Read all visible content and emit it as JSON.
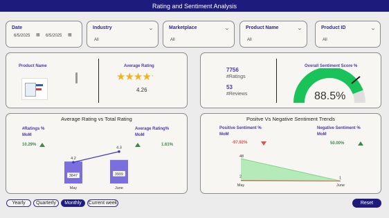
{
  "title": "Rating and Sentiment Analysis",
  "filters": {
    "date": {
      "label": "Date",
      "from": "6/5/2025",
      "to": "6/5/2025"
    },
    "industry": {
      "label": "Industry",
      "value": "All"
    },
    "marketplace": {
      "label": "Marketplace",
      "value": "All"
    },
    "product_name": {
      "label": "Product Name",
      "value": "All"
    },
    "product_id": {
      "label": "Product ID",
      "value": "All"
    }
  },
  "product_card": {
    "product_label": "Product Name",
    "avg_label": "Average Rating",
    "avg_value": "4.26",
    "stars": 4.26
  },
  "sentiment_card": {
    "ratings_count": "7756",
    "ratings_label": "#Ratings",
    "reviews_count": "53",
    "reviews_label": "#Reviews",
    "score_label": "Overall Sentiment Score %",
    "score_value": "88.5%",
    "score_fraction": 0.885
  },
  "avg_total_chart": {
    "title": "Average Rating vs Total Rating",
    "left_kpi_label_1": "#Ratings %",
    "left_kpi_label_2": "MoM",
    "left_kpi_value": "10.29%",
    "right_kpi_label_1": "Average Rating%",
    "right_kpi_label_2": "MoM",
    "right_kpi_value": "1.61%",
    "colors": {
      "bar": "#7b6fe0",
      "line": "#3b3ab8",
      "up": "#3a8a4a"
    }
  },
  "sentiment_chart": {
    "title": "Positve Vs Negative Sentiment Trends",
    "pos_label_1": "Positive Sentiment %",
    "pos_label_2": "MoM",
    "pos_value": "-97.92%",
    "neg_label_1": "Negative Sentiment %",
    "neg_label_2": "MoM",
    "neg_value": "50.00%",
    "colors": {
      "positive": "#9fe6a6",
      "negative": "#e04848",
      "down": "#d9534f",
      "up": "#3a8a4a"
    }
  },
  "chart_data": [
    {
      "type": "bar",
      "title": "Average Rating vs Total Rating",
      "categories": [
        "May",
        "June"
      ],
      "series": [
        {
          "values": [
            3847,
            3909
          ]
        },
        {
          "values": [
            4.2,
            4.3
          ]
        }
      ]
    },
    {
      "type": "area",
      "title": "Positve Vs Negative Sentiment Trends",
      "categories": [
        "May",
        "June"
      ],
      "series": [
        {
          "values": [
            48,
            1
          ]
        },
        {
          "values": [
            2,
            1
          ]
        }
      ]
    }
  ],
  "period_buttons": [
    "Yearly",
    "Quarterly",
    "Monthly",
    "Current week"
  ],
  "active_period": "Monthly",
  "reset_label": "Reset"
}
